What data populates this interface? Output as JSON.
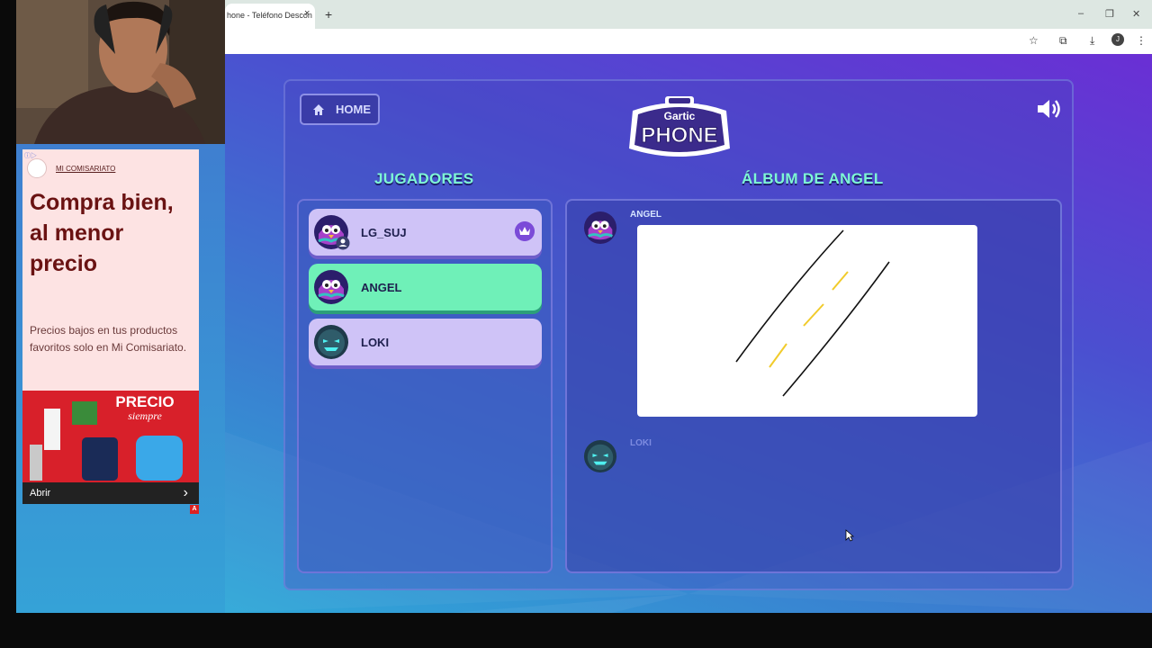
{
  "browser": {
    "tab_title": "hone - Teléfono Descon",
    "tab_close": "×",
    "new_tab": "+",
    "window_controls": [
      "–",
      "❐",
      "✕"
    ],
    "profile_initial": "J",
    "toolbar_icons": [
      "star-icon",
      "extensions-icon",
      "download-icon",
      "menu-icon"
    ]
  },
  "game": {
    "home_label": "HOME",
    "logo_top": "Gartic",
    "logo_bottom": "PHONE",
    "players_title": "JUGADORES",
    "album_title": "ÁLBUM DE ANGEL",
    "players": [
      {
        "name": "LG_SUJ",
        "active": false,
        "host": true
      },
      {
        "name": "ANGEL",
        "active": true,
        "host": false
      },
      {
        "name": "LOKI",
        "active": false,
        "host": false
      }
    ],
    "album": [
      {
        "name": "ANGEL"
      },
      {
        "name": "LOKI"
      }
    ],
    "colors": {
      "accent": "#7ef7d5",
      "active_player": "#6ff0b8",
      "player": "#cfc3f7"
    }
  },
  "ad": {
    "brand": "MI COMISARIATO",
    "headline": "Compra bien, al menor precio",
    "body": "Precios bajos en tus productos favoritos solo en Mi Comisariato.",
    "image_text_1": "PRECIO",
    "image_text_2": "siempre",
    "cta": "Abrir",
    "cta_arrow": "›",
    "badge": "A"
  }
}
